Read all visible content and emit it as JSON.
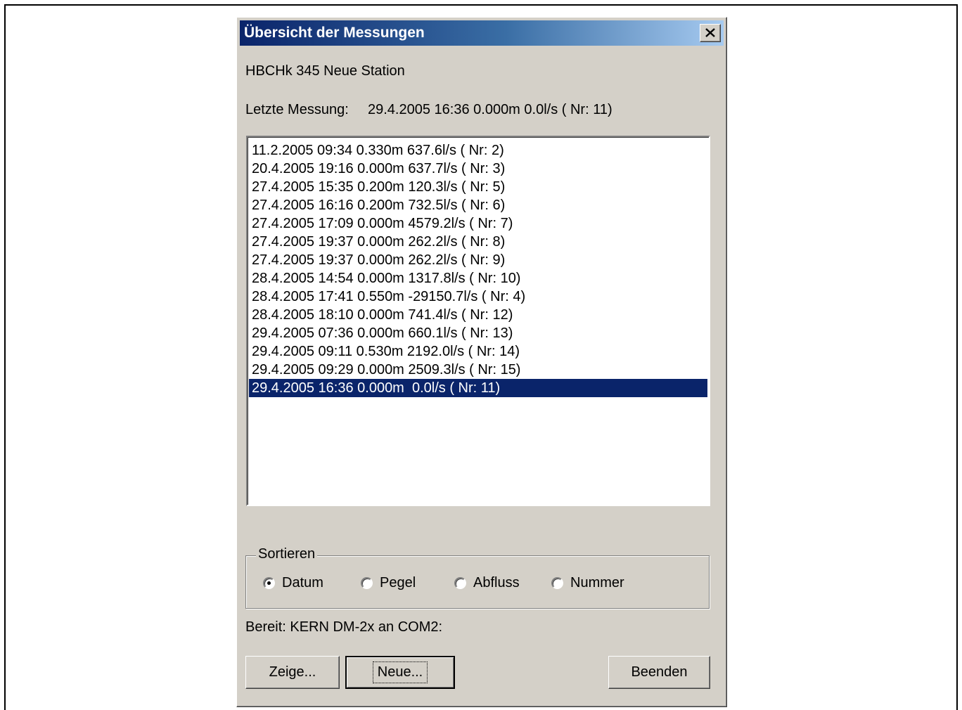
{
  "window": {
    "title": "Übersicht der Messungen",
    "close_glyph": "✕"
  },
  "station": "HBCHk 345 Neue Station",
  "last_measurement": {
    "label": "Letzte Messung:",
    "value": "29.4.2005 16:36 0.000m  0.0l/s ( Nr: 11)"
  },
  "measurements": [
    "11.2.2005 09:34 0.330m 637.6l/s ( Nr: 2)",
    "20.4.2005 19:16 0.000m 637.7l/s ( Nr: 3)",
    "27.4.2005 15:35 0.200m 120.3l/s ( Nr: 5)",
    "27.4.2005 16:16 0.200m 732.5l/s ( Nr: 6)",
    "27.4.2005 17:09 0.000m 4579.2l/s ( Nr: 7)",
    "27.4.2005 19:37 0.000m 262.2l/s ( Nr: 8)",
    "27.4.2005 19:37 0.000m 262.2l/s ( Nr: 9)",
    "28.4.2005 14:54 0.000m 1317.8l/s ( Nr: 10)",
    "28.4.2005 17:41 0.550m -29150.7l/s ( Nr: 4)",
    "28.4.2005 18:10 0.000m 741.4l/s ( Nr: 12)",
    "29.4.2005 07:36 0.000m 660.1l/s ( Nr: 13)",
    "29.4.2005 09:11 0.530m 2192.0l/s ( Nr: 14)",
    "29.4.2005 09:29 0.000m 2509.3l/s ( Nr: 15)",
    "29.4.2005 16:36 0.000m  0.0l/s ( Nr: 11)"
  ],
  "selected_index": 13,
  "sort": {
    "label": "Sortieren",
    "options": [
      "Datum",
      "Pegel",
      "Abfluss",
      "Nummer"
    ],
    "selected": "Datum"
  },
  "status": "Bereit: KERN DM-2x an COM2:",
  "buttons": {
    "show": "Zeige...",
    "new": "Neue...",
    "quit": "Beenden"
  },
  "colors": {
    "dialog_bg": "#d4d0c8",
    "title_start": "#0a246a",
    "title_end": "#a6caf0",
    "selection": "#0a246a"
  }
}
